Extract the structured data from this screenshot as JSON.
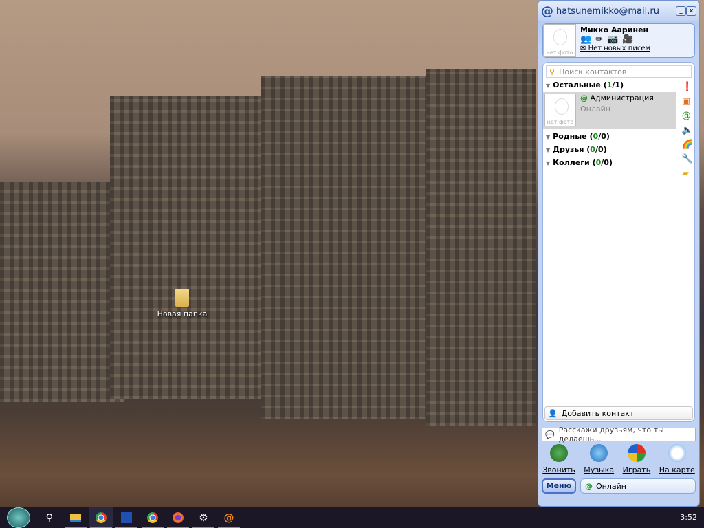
{
  "desktop": {
    "icons": [
      {
        "label": "Новая папка"
      }
    ]
  },
  "agent": {
    "title": "hatsunemikko@mail.ru",
    "minimize": "_",
    "close": "x",
    "profile": {
      "name": "Микко Ааринен",
      "no_photo": "нет фото",
      "mail_status": "Нет новых писем"
    },
    "search_placeholder": "Поиск контактов",
    "groups": [
      {
        "name": "Остальные",
        "online": "1",
        "total": "1"
      },
      {
        "name": "Родные",
        "online": "0",
        "total": "0"
      },
      {
        "name": "Друзья",
        "online": "0",
        "total": "0"
      },
      {
        "name": "Коллеги",
        "online": "0",
        "total": "0"
      }
    ],
    "contact": {
      "name": "Администрация",
      "status": "Онлайн",
      "no_photo": "нет фото"
    },
    "add_contact": "Добавить контакт",
    "status_placeholder": "Расскажи друзьям, что ты делаешь...",
    "actions": [
      {
        "label": "Звонить"
      },
      {
        "label": "Музыка"
      },
      {
        "label": "Играть"
      },
      {
        "label": "На карте"
      }
    ],
    "menu": "Меню",
    "status": "Онлайн"
  },
  "taskbar": {
    "clock": "3:52"
  }
}
